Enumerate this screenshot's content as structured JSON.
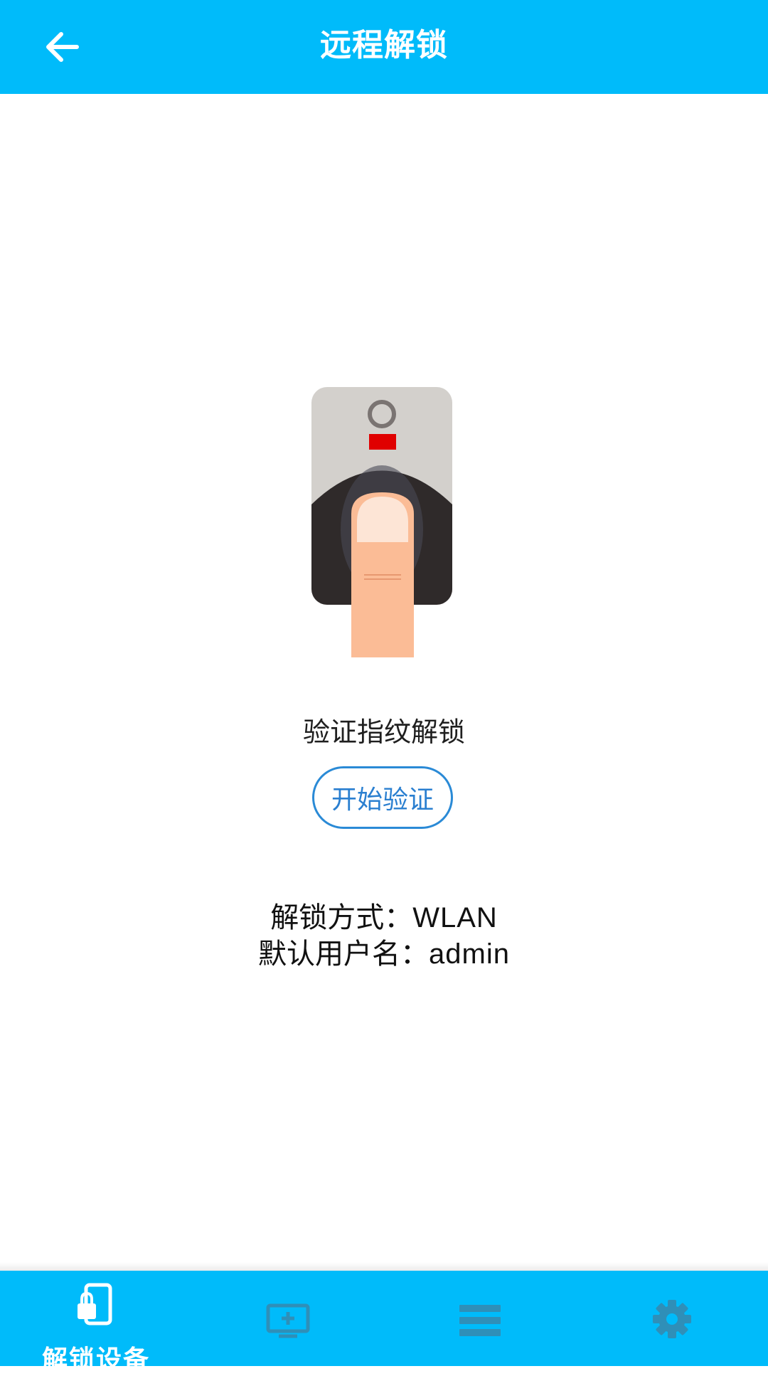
{
  "appbar": {
    "title": "远程解锁",
    "back_icon": "arrow-left-icon"
  },
  "main": {
    "illustration": "fingerprint-scanner-illustration",
    "verify_label": "验证指纹解锁",
    "verify_button": "开始验证",
    "method_label": "解锁方式：",
    "method_value": "WLAN",
    "user_label": "默认用户名：",
    "user_value": "admin"
  },
  "bottom_nav": {
    "items": [
      {
        "label": "解锁设备",
        "icon": "phone-lock-icon",
        "active": true
      },
      {
        "label": "",
        "icon": "monitor-add-icon",
        "active": false
      },
      {
        "label": "",
        "icon": "list-icon",
        "active": false
      },
      {
        "label": "",
        "icon": "gear-icon",
        "active": false
      }
    ]
  },
  "colors": {
    "primary": "#00bbfa",
    "accent": "#2a7fd0",
    "inactive_icon": "#2f8fb8"
  }
}
